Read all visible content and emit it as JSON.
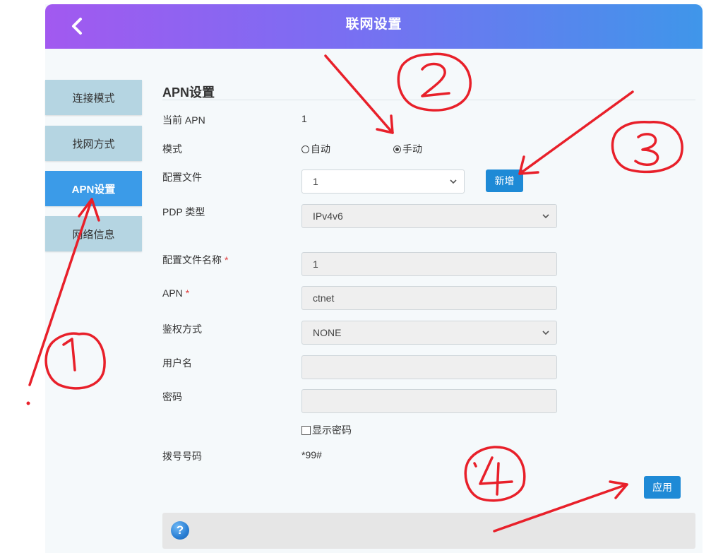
{
  "header": {
    "title": "联网设置",
    "back_icon": "chevron-left-icon"
  },
  "sidebar": {
    "items": [
      {
        "label": "连接模式",
        "active": false
      },
      {
        "label": "找网方式",
        "active": false
      },
      {
        "label": "APN设置",
        "active": true
      },
      {
        "label": "网络信息",
        "active": false
      }
    ]
  },
  "apn": {
    "section_title": "APN设置",
    "current_apn": {
      "label": "当前 APN",
      "value": "1"
    },
    "mode": {
      "label": "模式",
      "options": [
        "自动",
        "手动"
      ],
      "selected": "手动"
    },
    "profile": {
      "label": "配置文件",
      "value": "1",
      "add_button": "新增"
    },
    "pdp_type": {
      "label": "PDP 类型",
      "value": "IPv4v6"
    },
    "profile_name": {
      "label": "配置文件名称",
      "required_mark": "*",
      "value": "1"
    },
    "apn_name": {
      "label": "APN",
      "required_mark": "*",
      "value": "ctnet"
    },
    "auth": {
      "label": "鉴权方式",
      "value": "NONE"
    },
    "username": {
      "label": "用户名",
      "value": ""
    },
    "password": {
      "label": "密码",
      "value": ""
    },
    "show_password": {
      "label": "显示密码",
      "checked": false
    },
    "dial_number": {
      "label": "拨号号码",
      "value": "*99#"
    },
    "apply_button": "应用"
  },
  "help": {
    "icon": "question-icon",
    "glyph": "?"
  },
  "annotations": {
    "color": "#e8202a",
    "numbers": [
      "1",
      "2",
      "3",
      "4"
    ]
  },
  "colors": {
    "header_gradient_start": "#a259f0",
    "header_gradient_end": "#3f96ea",
    "sidebar_active": "#3b9be8",
    "sidebar_inactive": "#b5d5e2",
    "button": "#1e8ad6"
  }
}
